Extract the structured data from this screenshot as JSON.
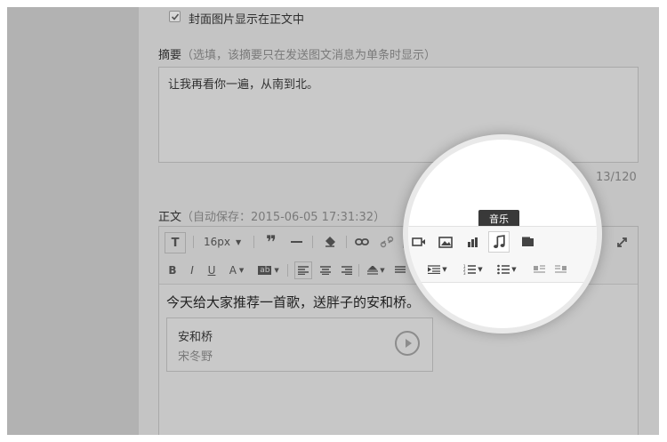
{
  "cover_option": {
    "label": "封面图片显示在正文中",
    "checked": true
  },
  "summary": {
    "label": "摘要",
    "hint": "（选填，该摘要只在发送图文消息为单条时显示）",
    "value": "让我再看你一遍，从南到北。",
    "counter": "13/120"
  },
  "body": {
    "label": "正文",
    "autosave": "（自动保存：2015-06-05 17:31:32）",
    "content": "今天给大家推荐一首歌，送胖子的安和桥。"
  },
  "toolbar": {
    "font_size": "16px",
    "tooltip": "音乐",
    "icons_row1": [
      "text-format-icon",
      "font-size-dropdown",
      "blockquote-icon",
      "horizontal-rule-icon",
      "eraser-icon",
      "link-icon",
      "unlink-icon",
      "video-icon",
      "image-icon",
      "vote-chart-icon",
      "music-icon",
      "card-icon",
      "fullscreen-icon"
    ],
    "icons_row2": [
      "bold-icon",
      "italic-icon",
      "underline-icon",
      "font-color-icon",
      "background-color-icon",
      "align-left-icon",
      "align-center-icon",
      "align-right-icon",
      "line-height-icon",
      "paragraph-spacing-icon",
      "indent-icon",
      "ordered-list-icon",
      "unordered-list-icon",
      "float-left-icon",
      "float-right-icon"
    ]
  },
  "music_card": {
    "title": "安和桥",
    "artist": "宋冬野"
  }
}
